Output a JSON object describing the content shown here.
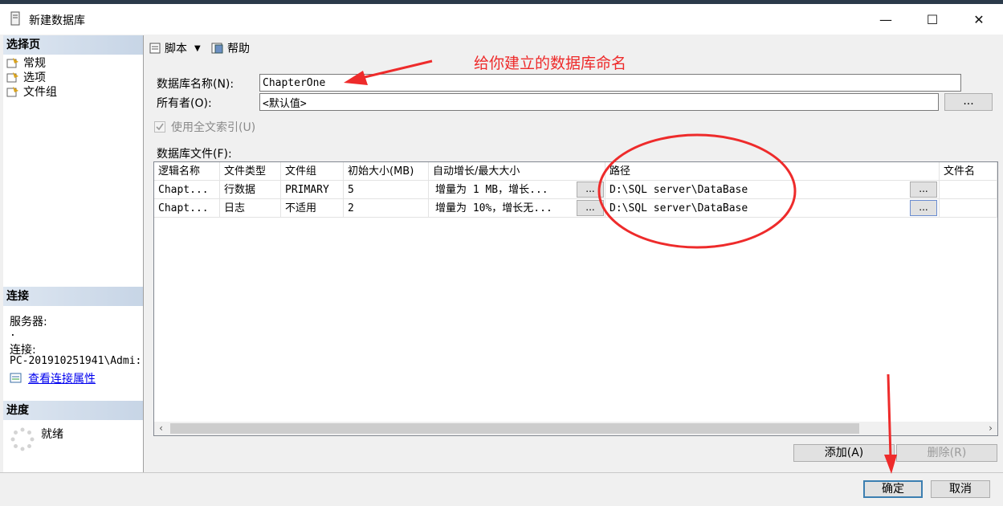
{
  "window": {
    "title": "新建数据库",
    "minimize": "—",
    "maximize": "☐",
    "close": "✕"
  },
  "sidebar": {
    "select_page_header": "选择页",
    "pages": [
      {
        "label": "常规",
        "icon": "page-settings-icon"
      },
      {
        "label": "选项",
        "icon": "page-settings-icon"
      },
      {
        "label": "文件组",
        "icon": "page-settings-icon"
      }
    ],
    "connection_header": "连接",
    "server_label": "服务器:",
    "server_value": ".",
    "connection_label": "连接:",
    "connection_value": "PC-201910251941\\Admi:",
    "view_properties_link": "查看连接属性",
    "progress_header": "进度",
    "progress_status": "就绪"
  },
  "toolbar": {
    "script_label": "脚本",
    "help_label": "帮助"
  },
  "form": {
    "db_name_label": "数据库名称(N):",
    "db_name_value": "ChapterOne",
    "owner_label": "所有者(O):",
    "owner_value": "<默认值>",
    "owner_browse": "...",
    "fulltext_label": "使用全文索引(U)",
    "fulltext_checked": true,
    "files_label": "数据库文件(F):"
  },
  "files_table": {
    "columns": [
      "逻辑名称",
      "文件类型",
      "文件组",
      "初始大小(MB)",
      "自动增长/最大大小",
      "路径",
      "文件名"
    ],
    "rows": [
      {
        "logical": "Chapt...",
        "type": "行数据",
        "group": "PRIMARY",
        "size": "5",
        "growth": "增量为 1 MB，增长...",
        "growth_btn": "...",
        "path": "D:\\SQL server\\DataBase",
        "path_btn": "...",
        "filename": ""
      },
      {
        "logical": "Chapt...",
        "type": "日志",
        "group": "不适用",
        "size": "2",
        "growth": "增量为 10%，增长无...",
        "growth_btn": "...",
        "path": "D:\\SQL server\\DataBase",
        "path_btn": "...",
        "filename": ""
      }
    ]
  },
  "actions": {
    "add_label": "添加(A)",
    "remove_label": "删除(R)"
  },
  "footer": {
    "ok_label": "确定",
    "cancel_label": "取消"
  },
  "annotation": {
    "text": "给你建立的数据库命名",
    "color": "#ee2b2b"
  }
}
